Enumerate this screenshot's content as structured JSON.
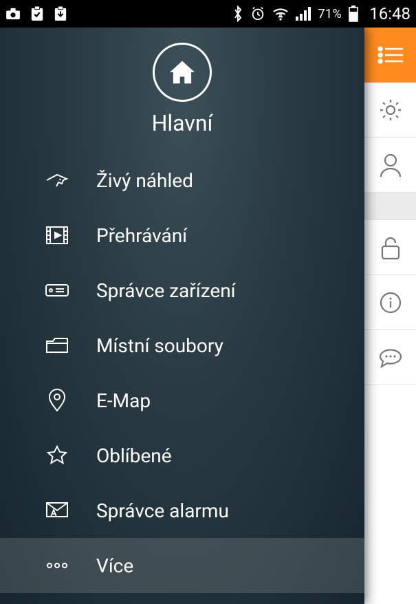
{
  "status": {
    "battery_pct": "71%",
    "clock": "16:48"
  },
  "drawer": {
    "title": "Hlavní",
    "items": [
      {
        "label": "Živý náhled",
        "icon": "camera-view-icon"
      },
      {
        "label": "Přehrávání",
        "icon": "playback-icon"
      },
      {
        "label": "Správce zařízení",
        "icon": "device-manager-icon"
      },
      {
        "label": "Místní soubory",
        "icon": "folder-icon"
      },
      {
        "label": "E-Map",
        "icon": "map-pin-icon"
      },
      {
        "label": "Oblíbené",
        "icon": "favorites-star-icon"
      },
      {
        "label": "Správce alarmu",
        "icon": "alarm-manager-icon"
      },
      {
        "label": "Více",
        "icon": "more-icon"
      }
    ],
    "selected_index": 7
  },
  "rail": {
    "items": [
      {
        "icon": "list-icon",
        "active": true
      },
      {
        "icon": "gear-icon"
      },
      {
        "icon": "user-icon"
      },
      {
        "spacer": true
      },
      {
        "icon": "lock-open-icon"
      },
      {
        "icon": "info-icon"
      },
      {
        "icon": "chat-bubble-icon"
      }
    ]
  }
}
